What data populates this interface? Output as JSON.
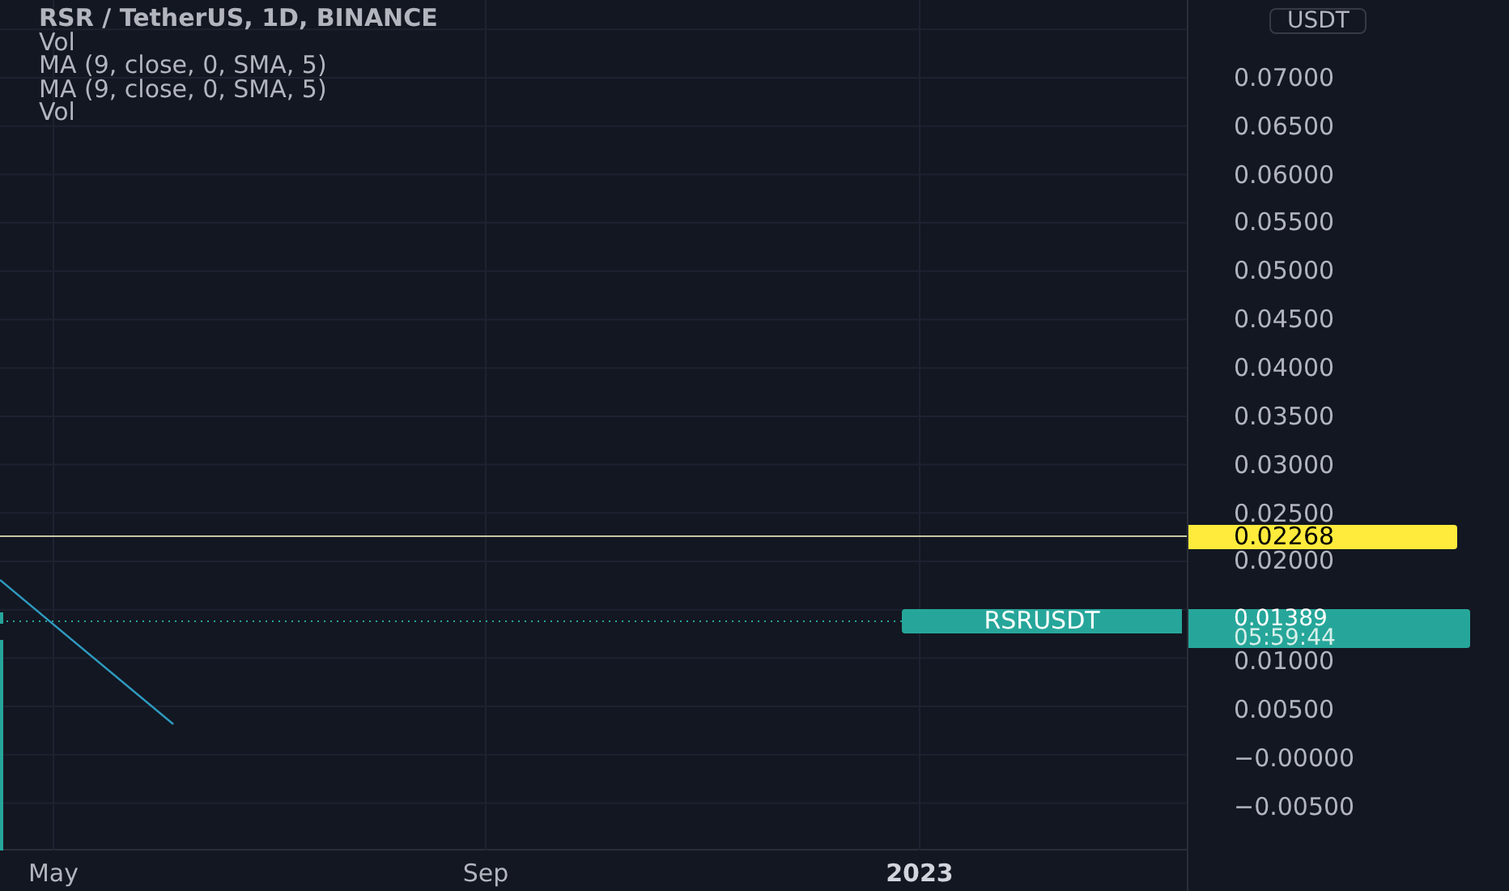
{
  "legend": {
    "title": "RSR / TetherUS, 1D, BINANCE",
    "indicators": [
      "Vol",
      "MA (9, close, 0, SMA, 5)",
      "MA (9, close, 0, SMA, 5)",
      "Vol"
    ]
  },
  "price_axis": {
    "currency": "USDT",
    "ticks_upper": [
      "0.07000",
      "0.06500",
      "0.06000",
      "0.05500",
      "0.05000",
      "0.04500",
      "0.04000",
      "0.03500",
      "0.03000",
      "0.02500",
      "0.02000"
    ],
    "ticks_lower": [
      "0.01000",
      "0.00500",
      "−0.00000",
      "−0.00500"
    ]
  },
  "alert_tag": {
    "price": "0.02268"
  },
  "symbol_tag": {
    "symbol": "RSRUSDT",
    "price": "0.01389",
    "countdown": "05:59:44"
  },
  "time_axis": [
    {
      "label": "May",
      "bold": false
    },
    {
      "label": "Sep",
      "bold": false
    },
    {
      "label": "2023",
      "bold": true
    }
  ]
}
